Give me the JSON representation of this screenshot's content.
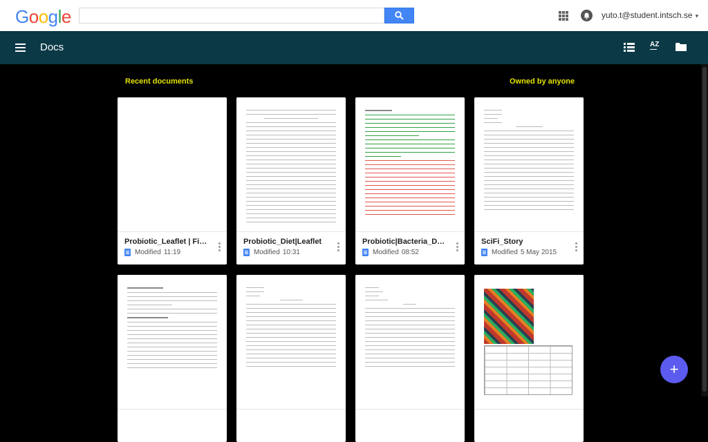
{
  "google_bar": {
    "logo_letters": [
      "G",
      "o",
      "o",
      "g",
      "l",
      "e"
    ],
    "logo_colors": [
      "#4285f4",
      "#ea4335",
      "#fbbc05",
      "#4285f4",
      "#34a853",
      "#ea4335"
    ],
    "search_value": "",
    "search_icon": "search-icon",
    "apps_icon": "apps-grid-icon",
    "notifications_icon": "bell-icon",
    "account_email": "yuto.t@student.intsch.se",
    "account_caret": "▾"
  },
  "docs_bar": {
    "title": "Docs",
    "menu_icon": "menu-icon",
    "actions": [
      "list-view-icon",
      "sort-az-icon",
      "folder-icon"
    ],
    "sort_label": "AZ",
    "background": "#0b3946"
  },
  "main": {
    "recent_heading": "Recent documents",
    "owner_filter": "Owned by anyone",
    "heading_color": "#e3e300",
    "documents": [
      {
        "title": "Probiotic_Leaflet | Final ...",
        "modified_label": "Modified",
        "modified": "11:19"
      },
      {
        "title": "Probiotic_Diet|Leaflet",
        "modified_label": "Modified",
        "modified": "10:31"
      },
      {
        "title": "Probiotic|Bacteria_Diet|R...",
        "modified_label": "Modified",
        "modified": "08:52"
      },
      {
        "title": "SciFi_Story",
        "modified_label": "Modified",
        "modified": "5 May 2015"
      }
    ]
  },
  "fab": {
    "label": "+",
    "color": "#5b5bf0"
  }
}
